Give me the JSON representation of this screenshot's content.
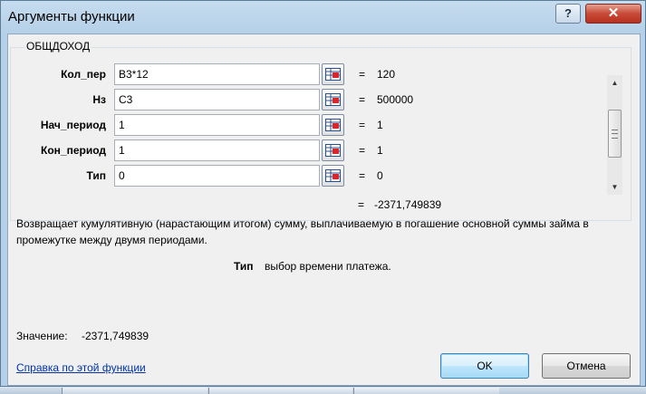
{
  "window": {
    "title": "Аргументы функции",
    "help_label": "?",
    "close_label": "✕"
  },
  "function_name": "ОБЩДОХОД",
  "arguments": [
    {
      "label": "Кол_пер",
      "value": "B3*12",
      "result": "120"
    },
    {
      "label": "Нз",
      "value": "C3",
      "result": "500000"
    },
    {
      "label": "Нач_период",
      "value": "1",
      "result": "1"
    },
    {
      "label": "Кон_период",
      "value": "1",
      "result": "1"
    },
    {
      "label": "Тип",
      "value": "0",
      "result": "0"
    }
  ],
  "equals_sign": "=",
  "formula_result": "-2371,749839",
  "description": "Возвращает кумулятивную (нарастающим итогом) сумму, выплачиваемую в погашение основной суммы займа в промежутке между двумя периодами.",
  "param_help": {
    "name": "Тип",
    "text": "выбор времени платежа."
  },
  "value_label": "Значение:",
  "value": "-2371,749839",
  "help_link": "Справка по этой функции",
  "buttons": {
    "ok": "OK",
    "cancel": "Отмена"
  }
}
